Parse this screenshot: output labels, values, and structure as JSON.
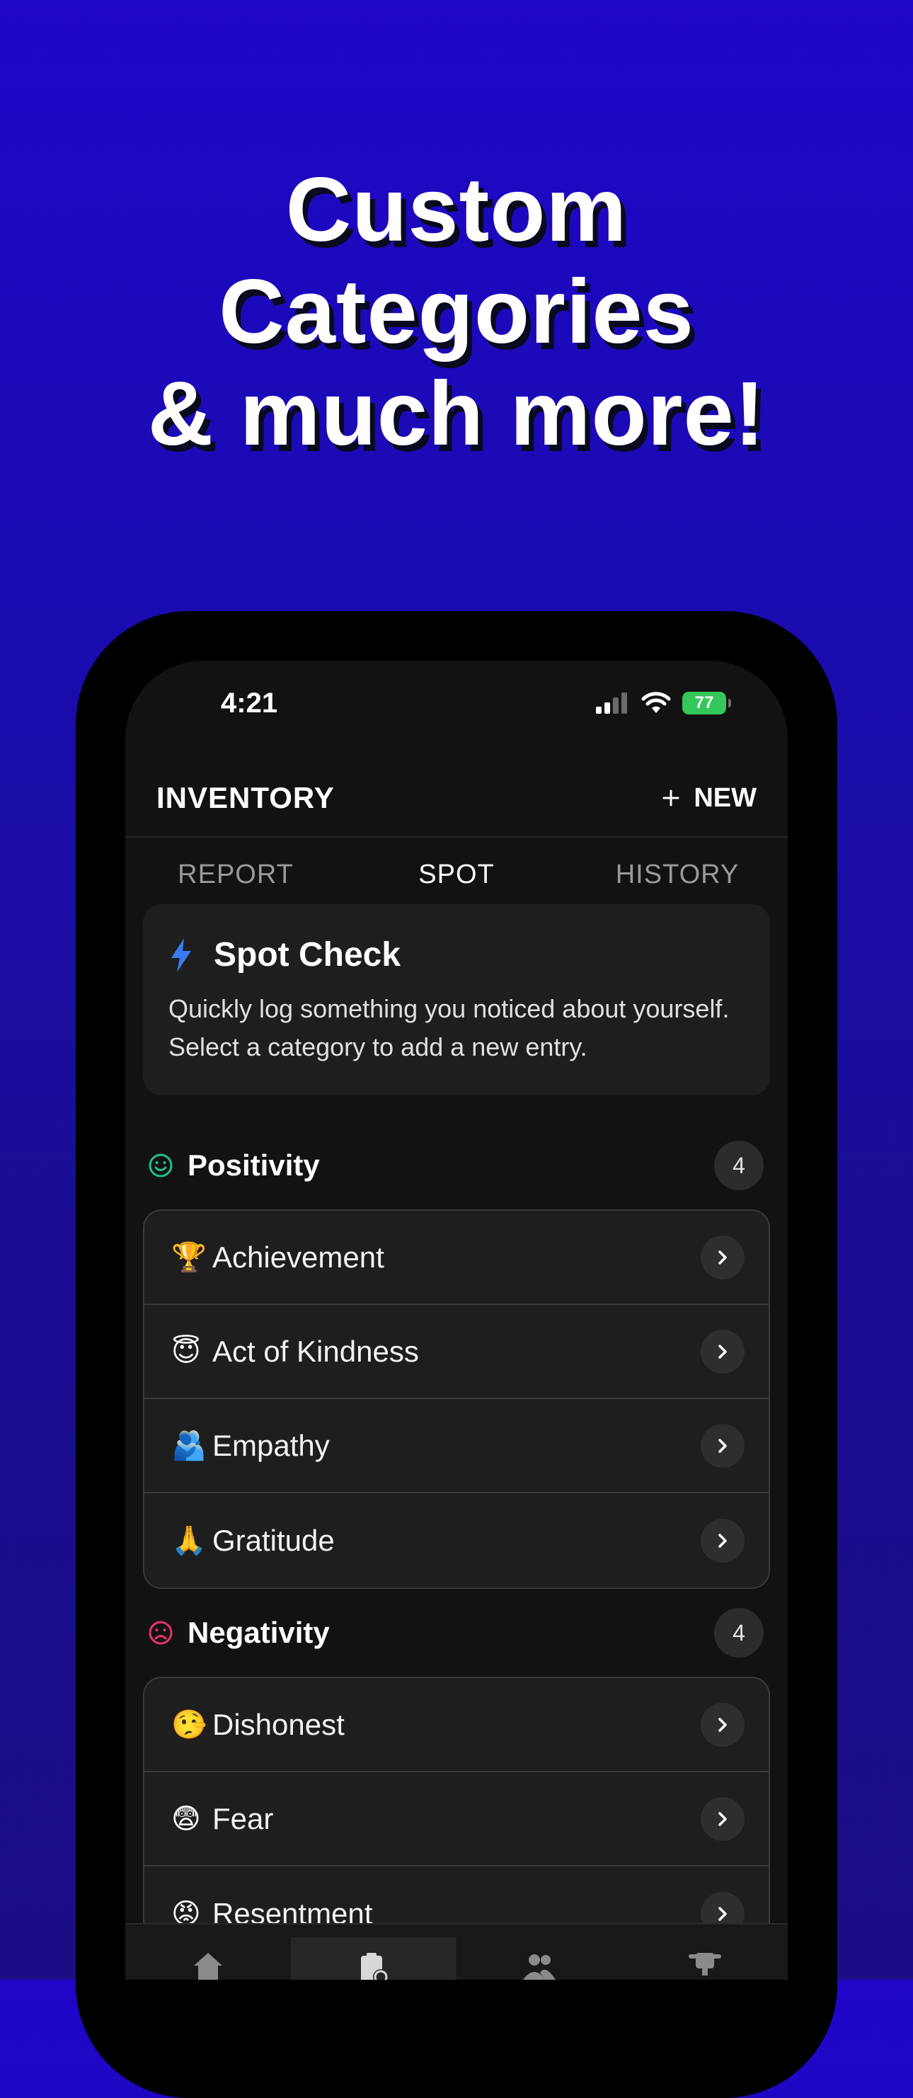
{
  "headline": {
    "line1": "Custom",
    "line2": "Categories",
    "line3": "& much more!"
  },
  "status_bar": {
    "time": "4:21",
    "battery": "77"
  },
  "app_bar": {
    "title": "INVENTORY",
    "new_label": "NEW"
  },
  "tabs": [
    {
      "label": "REPORT",
      "active": false
    },
    {
      "label": "SPOT",
      "active": true
    },
    {
      "label": "HISTORY",
      "active": false
    }
  ],
  "spot_card": {
    "title": "Spot Check",
    "description": "Quickly log something you noticed about yourself. Select a category to add a new entry."
  },
  "sections": [
    {
      "title": "Positivity",
      "count": "4",
      "icon": "smile-icon",
      "color": "#1fbf8f",
      "items": [
        {
          "emoji": "🏆",
          "label": "Achievement"
        },
        {
          "emoji": "😇",
          "label": "Act of Kindness"
        },
        {
          "emoji": "🫂",
          "label": "Empathy"
        },
        {
          "emoji": "🙏",
          "label": "Gratitude"
        }
      ]
    },
    {
      "title": "Negativity",
      "count": "4",
      "icon": "frown-icon",
      "color": "#e8336b",
      "items": [
        {
          "emoji": "🤥",
          "label": "Dishonest"
        },
        {
          "emoji": "😨",
          "label": "Fear"
        },
        {
          "emoji": "😡",
          "label": "Resentment"
        }
      ]
    }
  ],
  "colors": {
    "accent": "#3a7bf5",
    "background_top": "#1f06c8",
    "background_bottom": "#1b0e84"
  },
  "bottom_tabs": [
    "home-icon",
    "inventory-icon",
    "people-icon",
    "trophy-icon"
  ]
}
